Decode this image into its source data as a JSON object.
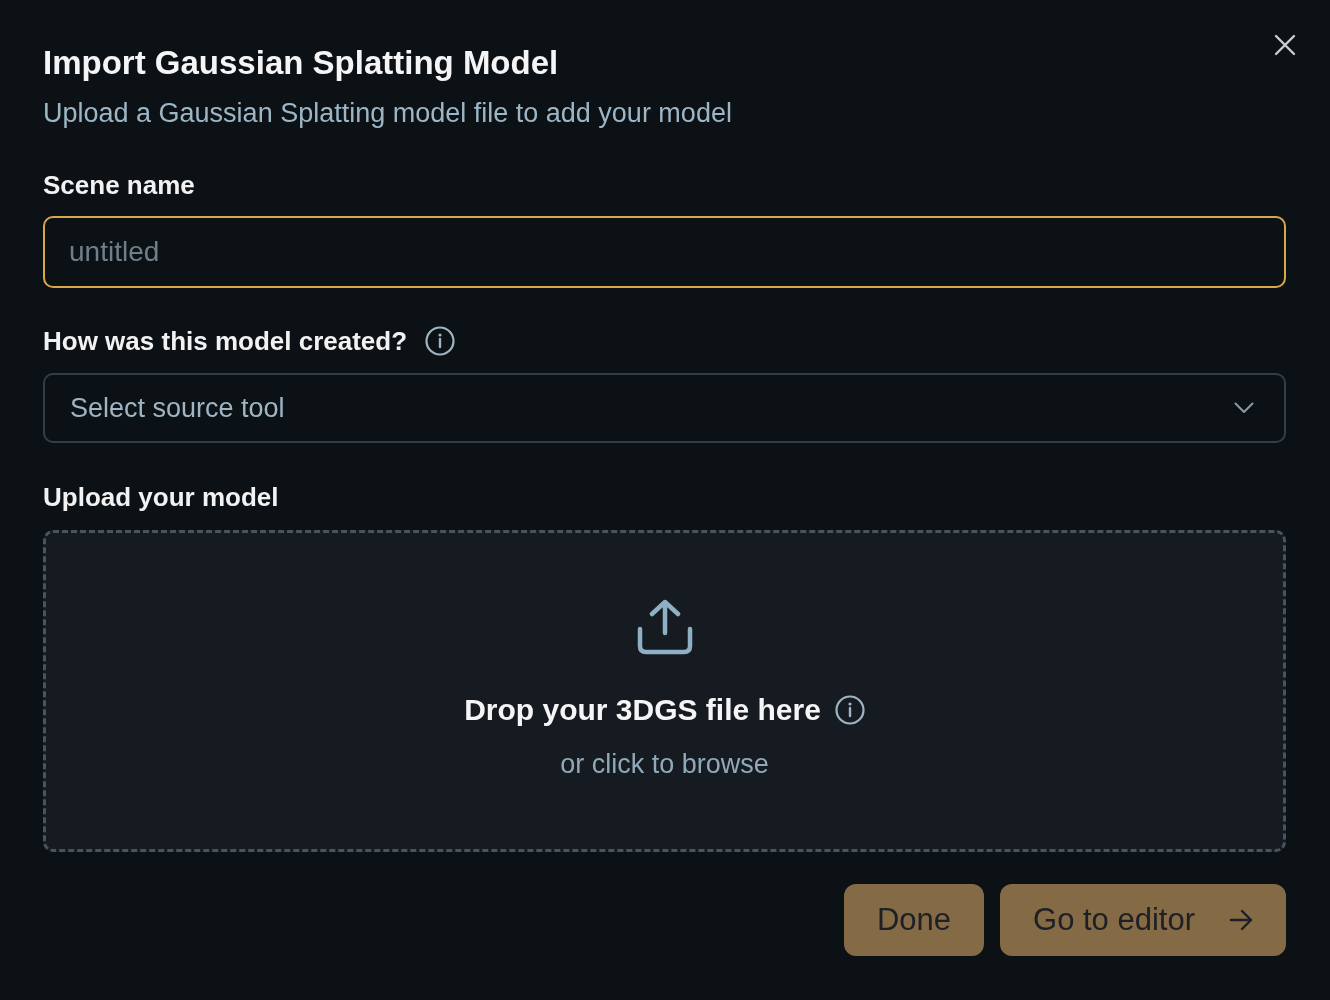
{
  "dialog": {
    "title": "Import Gaussian Splatting Model",
    "subtitle": "Upload a Gaussian Splatting model file to add your model"
  },
  "fields": [
    {
      "kind": "text",
      "label": "Scene name",
      "placeholder": "untitled",
      "focused": true,
      "info": false
    },
    {
      "kind": "select",
      "label": "How was this model created?",
      "placeholder": "Select source tool",
      "focused": false,
      "info": true
    }
  ],
  "upload": {
    "label": "Upload your model",
    "prompt": "Drop your 3DGS file here",
    "hint": "or click to browse"
  },
  "buttons": [
    {
      "kind": "plain",
      "label": "Done",
      "disabled": true
    },
    {
      "kind": "next",
      "label": "Go to editor",
      "disabled": true
    }
  ]
}
